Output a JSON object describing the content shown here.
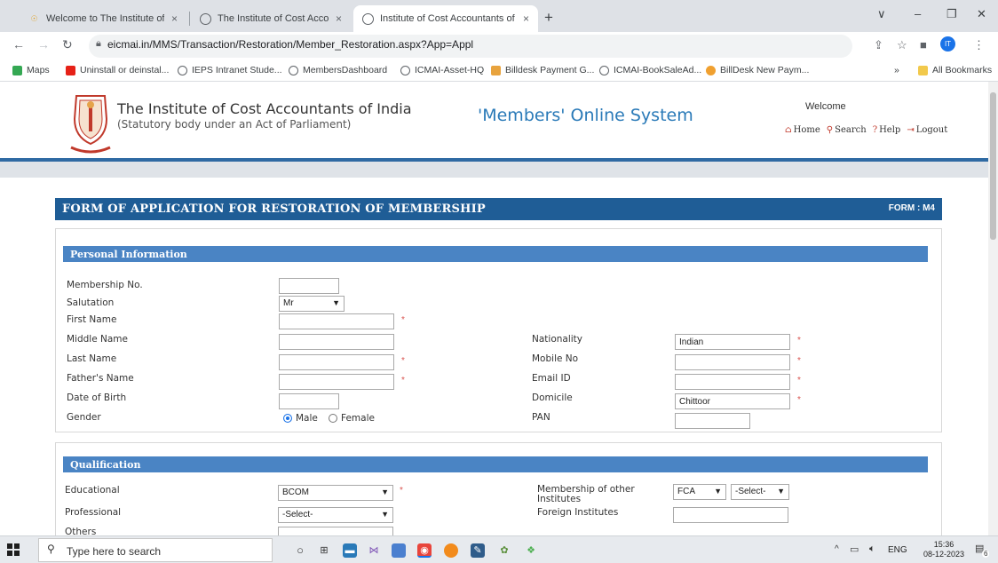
{
  "browser": {
    "tabs": [
      {
        "title": "Welcome to The Institute of Cos",
        "close": "×"
      },
      {
        "title": "The Institute of Cost Accountant",
        "close": "×"
      },
      {
        "title": "Institute of Cost Accountants of",
        "close": "×"
      }
    ],
    "new_tab": "+",
    "window_controls": {
      "menu": "∨",
      "minimize": "–",
      "restore": "❐",
      "close": "✕"
    },
    "url": "eicmai.in/MMS/Transaction/Restoration/Member_Restoration.aspx?App=Appl",
    "profile_initials": "IT",
    "bookmarks": [
      "Maps",
      "Uninstall or deinstal...",
      "IEPS Intranet Stude...",
      "MembersDashboard",
      "ICMAI-Asset-HQ",
      "Billdesk Payment G...",
      "ICMAI-BookSaleAd...",
      "BillDesk New Paym..."
    ],
    "bookmarks_overflow": "»",
    "all_bookmarks": "All Bookmarks"
  },
  "header": {
    "institute_name": "The Institute of Cost Accountants of India",
    "institute_sub": "(Statutory body under an Act of Parliament)",
    "system_title": "'Members' Online System",
    "welcome": "Welcome",
    "links": {
      "home": "Home",
      "search": "Search",
      "help": "Help",
      "logout": "Logout"
    }
  },
  "form": {
    "title": "FORM OF APPLICATION FOR RESTORATION OF MEMBERSHIP",
    "code": "FORM : M4",
    "personal": {
      "section_title": "Personal Information",
      "labels": {
        "membership_no": "Membership No.",
        "salutation": "Salutation",
        "first_name": "First Name",
        "middle_name": "Middle Name",
        "last_name": "Last Name",
        "fathers_name": "Father's Name",
        "dob": "Date of Birth",
        "gender": "Gender",
        "nationality": "Nationality",
        "mobile": "Mobile No",
        "email": "Email ID",
        "domicile": "Domicile",
        "pan": "PAN"
      },
      "values": {
        "salutation": "Mr",
        "nationality": "Indian",
        "domicile": "Chittoor"
      },
      "gender_options": {
        "male": "Male",
        "female": "Female",
        "selected": "Male"
      },
      "required_mark": "*"
    },
    "qualification": {
      "section_title": "Qualification",
      "labels": {
        "educational": "Educational",
        "professional": "Professional",
        "others": "Others",
        "membership_other": "Membership of other Institutes",
        "foreign": "Foreign Institutes"
      },
      "values": {
        "educational": "BCOM",
        "professional": "-Select-",
        "membership_other_1": "FCA",
        "membership_other_2": "-Select-"
      }
    }
  },
  "taskbar": {
    "search_placeholder": "Type here to search",
    "language": "ENG",
    "time": "15:36",
    "date": "08-12-2023",
    "notification_count": "6"
  }
}
